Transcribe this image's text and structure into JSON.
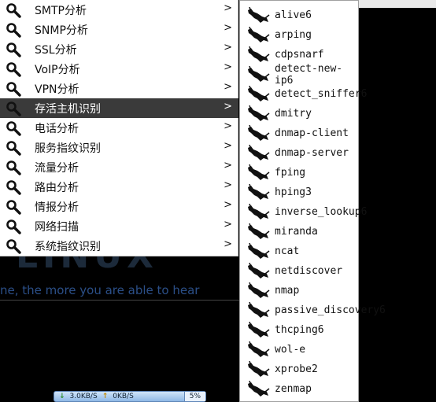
{
  "desktop": {
    "logo": "LINUX",
    "tagline": "ne, the more you are able to hear"
  },
  "network_monitor": {
    "download": "3.0KB/S",
    "upload": "0KB/S",
    "cpu": "5%"
  },
  "category_menu": {
    "selected_index": 5,
    "items": [
      {
        "label": "SMTP分析"
      },
      {
        "label": "SNMP分析"
      },
      {
        "label": "SSL分析"
      },
      {
        "label": "VoIP分析"
      },
      {
        "label": "VPN分析"
      },
      {
        "label": "存活主机识别"
      },
      {
        "label": "电话分析"
      },
      {
        "label": "服务指纹识别"
      },
      {
        "label": "流量分析"
      },
      {
        "label": "路由分析"
      },
      {
        "label": "情报分析"
      },
      {
        "label": "网络扫描"
      },
      {
        "label": "系统指纹识别"
      }
    ],
    "submenu_arrow": ">"
  },
  "tools_menu": {
    "items": [
      {
        "label": "alive6"
      },
      {
        "label": "arping"
      },
      {
        "label": "cdpsnarf"
      },
      {
        "label": "detect-new-ip6"
      },
      {
        "label": "detect_sniffer6"
      },
      {
        "label": "dmitry"
      },
      {
        "label": "dnmap-client"
      },
      {
        "label": "dnmap-server"
      },
      {
        "label": "fping"
      },
      {
        "label": "hping3"
      },
      {
        "label": "inverse_lookup6"
      },
      {
        "label": "miranda"
      },
      {
        "label": "ncat"
      },
      {
        "label": "netdiscover"
      },
      {
        "label": "nmap"
      },
      {
        "label": "passive_discovery6"
      },
      {
        "label": "thcping6"
      },
      {
        "label": "wol-e"
      },
      {
        "label": "xprobe2"
      },
      {
        "label": "zenmap"
      }
    ]
  },
  "icons": {
    "category_icon": "magnifier-icon",
    "tool_icon": "kali-dragon-icon"
  }
}
